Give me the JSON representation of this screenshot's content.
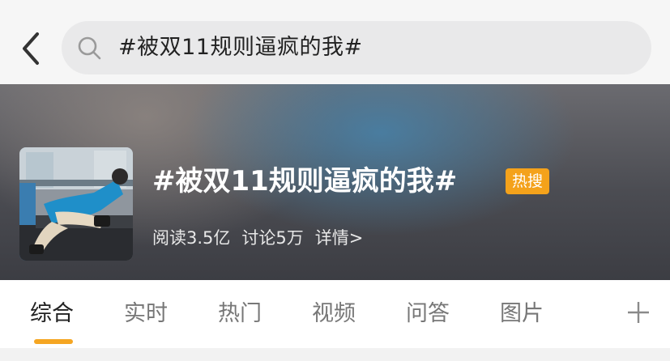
{
  "search": {
    "query": "#被双11规则逼疯的我#"
  },
  "topic": {
    "title": "#被双11规则逼疯的我#",
    "badge": "热搜",
    "reads": "阅读3.5亿",
    "discussions": "讨论5万",
    "details": "详情>"
  },
  "tabs": [
    "综合",
    "实时",
    "热门",
    "视频",
    "问答",
    "图片"
  ],
  "active_tab": "综合",
  "colors": {
    "accent": "#f5a623",
    "badge": "#f4a21b"
  },
  "icons": {
    "back": "chevron-left-icon",
    "search": "search-icon",
    "add": "plus-icon"
  }
}
